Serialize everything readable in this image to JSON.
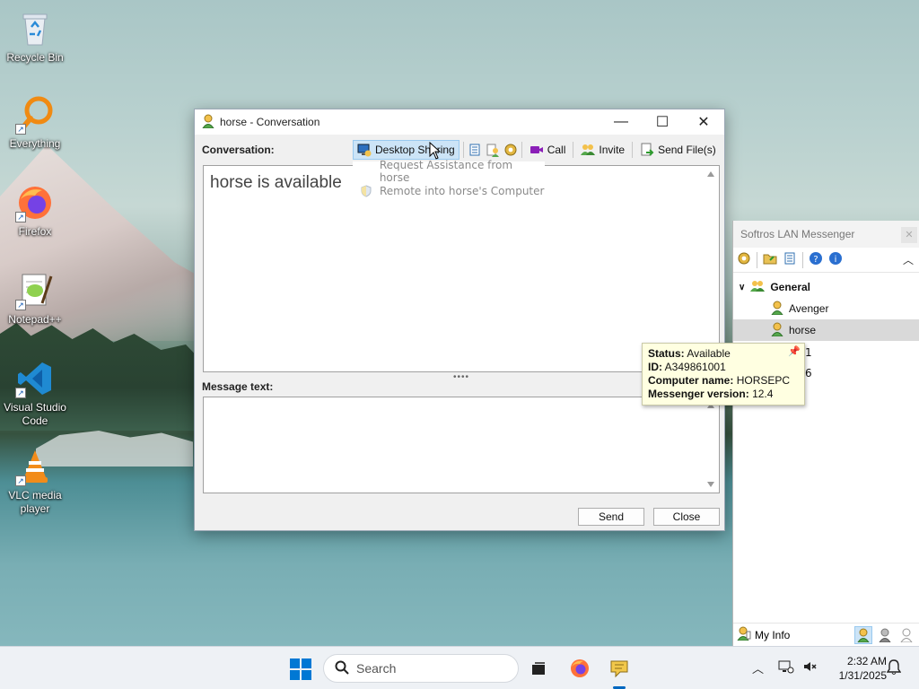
{
  "desktop": {
    "icons": [
      {
        "label": "Recycle Bin"
      },
      {
        "label": "Everything"
      },
      {
        "label": "Firefox"
      },
      {
        "label": "Notepad++"
      },
      {
        "label": "Visual Studio Code"
      },
      {
        "label": "VLC media player"
      }
    ]
  },
  "conversation": {
    "title": "horse - Conversation",
    "conversation_label": "Conversation:",
    "toolbar": {
      "desktop_sharing": "Desktop Sharing",
      "call": "Call",
      "invite": "Invite",
      "send_files": "Send File(s)"
    },
    "status_message": "horse is available",
    "message_label": "Message text:",
    "send_button": "Send",
    "close_button": "Close",
    "menu": [
      {
        "label": "Request Assistance from horse"
      },
      {
        "label": "Remote into horse's Computer"
      }
    ]
  },
  "lan": {
    "title": "Softros LAN Messenger",
    "group": "General",
    "members": [
      {
        "name": "Avenger"
      },
      {
        "name": "horse"
      }
    ],
    "partial_row_1": "1",
    "partial_row_2": "6",
    "my_info": "My Info"
  },
  "tooltip": {
    "status_label": "Status:",
    "status_value": "Available",
    "id_label": "ID:",
    "id_value": "A349861001",
    "computer_label": "Computer name:",
    "computer_value": "HORSEPC",
    "version_label": "Messenger version:",
    "version_value": "12.4"
  },
  "taskbar": {
    "search_placeholder": "Search",
    "time": "2:32 AM",
    "date": "1/31/2025"
  },
  "colors": {
    "accent": "#0067c0",
    "selection": "#cce4f7",
    "tooltip_bg": "#ffffe1"
  }
}
